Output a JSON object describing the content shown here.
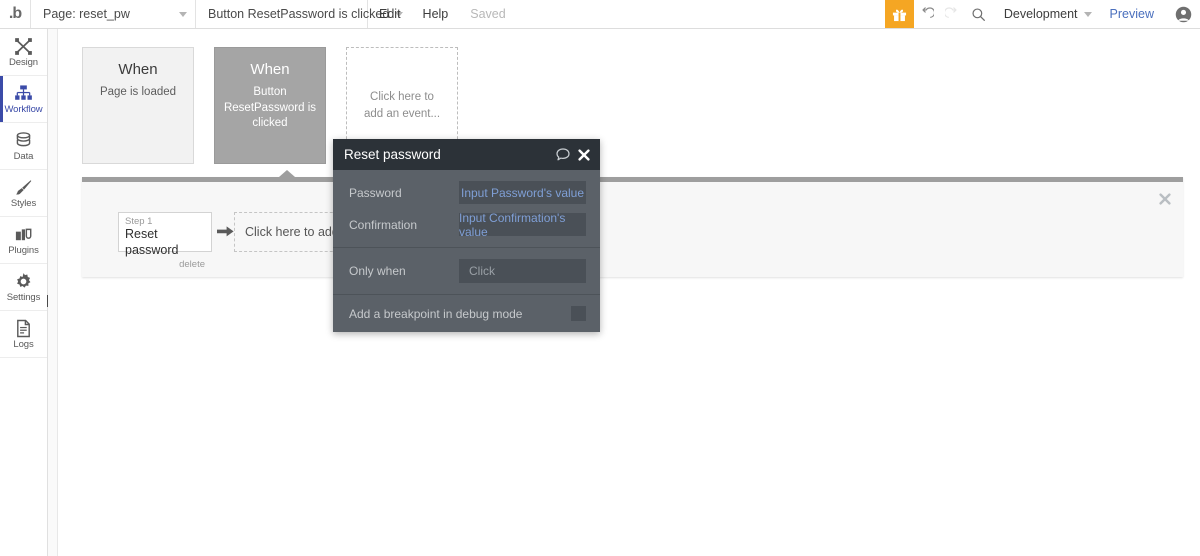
{
  "app": {
    "logo": "bubble-logo",
    "logo_text": ".b"
  },
  "topbar": {
    "page_selector": {
      "label": "Page: reset_pw",
      "icon": "chevron-down-icon"
    },
    "event_selector": {
      "label": "Button ResetPassword is clicked",
      "icon": "chevron-down-icon"
    },
    "edit_label": "Edit",
    "help_label": "Help",
    "save_status": "Saved",
    "gift_icon": "gift-icon",
    "undo_icon": "undo-icon",
    "redo_icon": "redo-icon",
    "search_icon": "search-icon",
    "version_selector": {
      "label": "Development",
      "icon": "chevron-down-icon"
    },
    "preview_label": "Preview",
    "avatar_icon": "user-avatar-icon",
    "accent_color": "#f5a623",
    "link_color": "#4a6fbd"
  },
  "sidebar": {
    "items": [
      {
        "label": "Design",
        "icon": "design-tools-icon",
        "active": false
      },
      {
        "label": "Workflow",
        "icon": "workflow-hierarchy-icon",
        "active": true
      },
      {
        "label": "Data",
        "icon": "database-icon",
        "active": false
      },
      {
        "label": "Styles",
        "icon": "paintbrush-icon",
        "active": false
      },
      {
        "label": "Plugins",
        "icon": "plugins-icon",
        "active": false
      },
      {
        "label": "Settings",
        "icon": "gear-icon",
        "active": false
      },
      {
        "label": "Logs",
        "icon": "document-lines-icon",
        "active": false
      }
    ],
    "active_color": "#3b4ba8",
    "collapse_icon": "collapse-arrow-icon"
  },
  "workflow": {
    "events": [
      {
        "when_label": "When",
        "description": "Page is loaded",
        "state": "plain"
      },
      {
        "when_label": "When",
        "description": "Button ResetPassword is clicked",
        "state": "selected"
      },
      {
        "add_text": "Click here to add an event...",
        "state": "add"
      }
    ],
    "actions_panel": {
      "close_icon": "close-icon",
      "step": {
        "number_label": "Step 1",
        "title": "Reset password",
        "delete_label": "delete"
      },
      "arrow_icon": "arrow-right-icon",
      "add_action_text": "Click here to add an action..."
    }
  },
  "modal": {
    "title": "Reset password",
    "comment_icon": "comment-bubble-icon",
    "close_icon": "close-icon",
    "fields": [
      {
        "label": "Password",
        "value": "Input Password's value"
      },
      {
        "label": "Confirmation",
        "value": "Input Confirmation's value"
      }
    ],
    "condition": {
      "label": "Only when",
      "placeholder": "Click"
    },
    "breakpoint": {
      "label": "Add a breakpoint in debug mode",
      "checked": false
    },
    "header_color": "#2c3238",
    "body_color": "#5b6168",
    "value_link_color": "#7f9fd6"
  }
}
